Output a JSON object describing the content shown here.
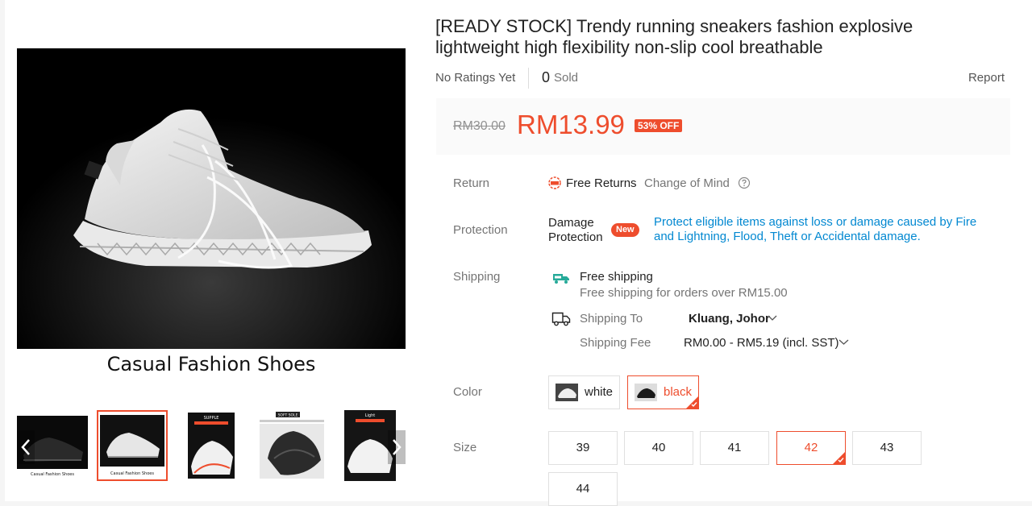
{
  "gallery": {
    "caption": "Casual Fashion Shoes",
    "thumbnails": [
      {
        "name": "thumb-black-sneaker",
        "caption": "Casual Fashion Shoes"
      },
      {
        "name": "thumb-white-sneaker",
        "caption": "Casual Fashion Shoes",
        "selected": true
      },
      {
        "name": "thumb-supple",
        "caption": "SUPPLE"
      },
      {
        "name": "thumb-soft-sole",
        "caption": "SOFT SOLE"
      },
      {
        "name": "thumb-light",
        "caption": "Light"
      }
    ]
  },
  "product": {
    "title": "[READY STOCK] Trendy running sneakers fashion explosive lightweight high flexibility non-slip cool breathable",
    "ratings_text": "No Ratings Yet",
    "sold_count": "0",
    "sold_label": "Sold",
    "report_label": "Report"
  },
  "price": {
    "original": "RM30.00",
    "current": "RM13.99",
    "discount": "53% OFF"
  },
  "return": {
    "label": "Return",
    "value": "Free Returns",
    "extra": "Change of Mind"
  },
  "protection": {
    "label": "Protection",
    "name_line1": "Damage",
    "name_line2": "Protection",
    "badge": "New",
    "description": "Protect eligible items against loss or damage caused by Fire and Lightning, Flood, Theft or Accidental damage."
  },
  "shipping": {
    "label": "Shipping",
    "free_title": "Free shipping",
    "free_subtitle": "Free shipping for orders over RM15.00",
    "to_label": "Shipping To",
    "to_value": "Kluang, Johor",
    "fee_label": "Shipping Fee",
    "fee_value": "RM0.00 - RM5.19 (incl. SST)"
  },
  "variation": {
    "color_label": "Color",
    "colors": [
      "white",
      "black"
    ],
    "selected_color": "black",
    "size_label": "Size",
    "sizes": [
      "39",
      "40",
      "41",
      "42",
      "43",
      "44"
    ],
    "selected_size": "42"
  },
  "colors": {
    "accent": "#ee4d2d",
    "link": "#0288d1",
    "free_shipping": "#26aa99"
  },
  "icons": {
    "free_returns": "free-returns-icon",
    "help": "question-circle-icon",
    "free_shipping": "free-shipping-truck-icon",
    "shipping_to": "delivery-truck-icon",
    "dropdown": "chevron-down-icon",
    "thumb_prev": "chevron-left-icon",
    "thumb_next": "chevron-right-icon"
  }
}
